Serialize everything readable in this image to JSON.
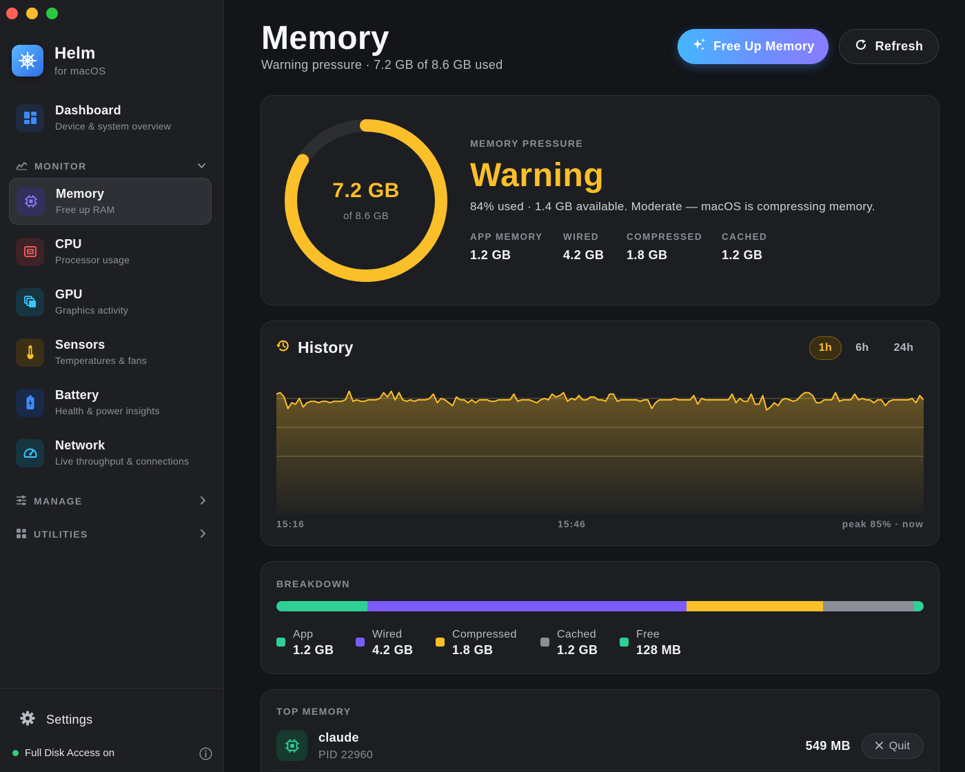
{
  "app": {
    "name": "Helm",
    "subtitle": "for macOS"
  },
  "sidebar": {
    "dashboard": {
      "title": "Dashboard",
      "subtitle": "Device & system overview"
    },
    "monitor_header": "MONITOR",
    "items": [
      {
        "title": "Memory",
        "subtitle": "Free up RAM",
        "icon": "chip-icon",
        "color": "#8b7bff",
        "active": true
      },
      {
        "title": "CPU",
        "subtitle": "Processor usage",
        "icon": "cpu-icon",
        "color": "#ff5f5f"
      },
      {
        "title": "GPU",
        "subtitle": "Graphics activity",
        "icon": "layers-icon",
        "color": "#35c8ff"
      },
      {
        "title": "Sensors",
        "subtitle": "Temperatures & fans",
        "icon": "thermometer-icon",
        "color": "#fbbf2a"
      },
      {
        "title": "Battery",
        "subtitle": "Health & power insights",
        "icon": "battery-icon",
        "color": "#3d8bff"
      },
      {
        "title": "Network",
        "subtitle": "Live throughput & connections",
        "icon": "gauge-icon",
        "color": "#35c8ff"
      }
    ],
    "manage_header": "MANAGE",
    "utilities_header": "UTILITIES",
    "settings_label": "Settings",
    "fda_label": "Full Disk Access on"
  },
  "header": {
    "title": "Memory",
    "subtitle": "Warning pressure · 7.2 GB of 8.6 GB used",
    "free_button": "Free Up Memory",
    "refresh_button": "Refresh"
  },
  "pressure": {
    "gauge_value": "7.2 GB",
    "gauge_sub": "of 8.6 GB",
    "used_fraction": 0.84,
    "label": "MEMORY PRESSURE",
    "status": "Warning",
    "description": "84% used · 1.4 GB available. Moderate — macOS is compressing memory.",
    "stats": [
      {
        "label": "APP MEMORY",
        "value": "1.2 GB"
      },
      {
        "label": "WIRED",
        "value": "4.2 GB"
      },
      {
        "label": "COMPRESSED",
        "value": "1.8 GB"
      },
      {
        "label": "CACHED",
        "value": "1.2 GB"
      }
    ],
    "accent": "#fbbf2a"
  },
  "history": {
    "title": "History",
    "ranges": [
      "1h",
      "6h",
      "24h"
    ],
    "selected_range": "1h",
    "axis_start": "15:16",
    "axis_mid": "15:46",
    "axis_end": "peak 85% · now"
  },
  "chart_data": {
    "type": "area",
    "ylim": [
      0,
      100
    ],
    "values": [
      83,
      84,
      81,
      73,
      77,
      76,
      80,
      74,
      77,
      78,
      78,
      77,
      78,
      78,
      77,
      78,
      78,
      78,
      79,
      85,
      78,
      79,
      78,
      78,
      79,
      79,
      79,
      80,
      84,
      81,
      85,
      79,
      84,
      79,
      78,
      79,
      78,
      79,
      79,
      79,
      80,
      83,
      77,
      80,
      79,
      77,
      75,
      81,
      79,
      79,
      77,
      79,
      77,
      79,
      79,
      79,
      78,
      78,
      79,
      79,
      79,
      79,
      83,
      78,
      79,
      79,
      79,
      78,
      77,
      79,
      80,
      79,
      83,
      81,
      82,
      84,
      78,
      80,
      79,
      82,
      79,
      79,
      81,
      81,
      79,
      79,
      78,
      83,
      83,
      78,
      79,
      79,
      79,
      79,
      79,
      78,
      79,
      79,
      73,
      77,
      79,
      79,
      79,
      79,
      80,
      79,
      79,
      79,
      79,
      82,
      76,
      80,
      79,
      79,
      79,
      79,
      79,
      79,
      79,
      83,
      77,
      80,
      78,
      78,
      83,
      76,
      76,
      82,
      72,
      74,
      77,
      75,
      79,
      80,
      79,
      78,
      79,
      82,
      84,
      84,
      82,
      77,
      77,
      79,
      79,
      79,
      84,
      78,
      79,
      79,
      79,
      83,
      79,
      80,
      79,
      79,
      77,
      79,
      79,
      75,
      78,
      79,
      79,
      79,
      79,
      79,
      80,
      77,
      82,
      79
    ],
    "grid": true,
    "gridlines": [
      40,
      60,
      80
    ]
  },
  "breakdown": {
    "label": "BREAKDOWN",
    "segments": [
      {
        "name": "App",
        "value": "1.2 GB",
        "gb": 1.2,
        "color": "#2fd095"
      },
      {
        "name": "Wired",
        "value": "4.2 GB",
        "gb": 4.2,
        "color": "#7c5cff"
      },
      {
        "name": "Compressed",
        "value": "1.8 GB",
        "gb": 1.8,
        "color": "#fbbf2a"
      },
      {
        "name": "Cached",
        "value": "1.2 GB",
        "gb": 1.2,
        "color": "#8a8e96"
      },
      {
        "name": "Free",
        "value": "128 MB",
        "gb": 0.128,
        "color": "#2fd095"
      }
    ]
  },
  "top_memory": {
    "label": "TOP MEMORY",
    "processes": [
      {
        "name": "claude",
        "pid": "PID 22960",
        "memory": "549 MB",
        "action": "Quit"
      }
    ]
  }
}
